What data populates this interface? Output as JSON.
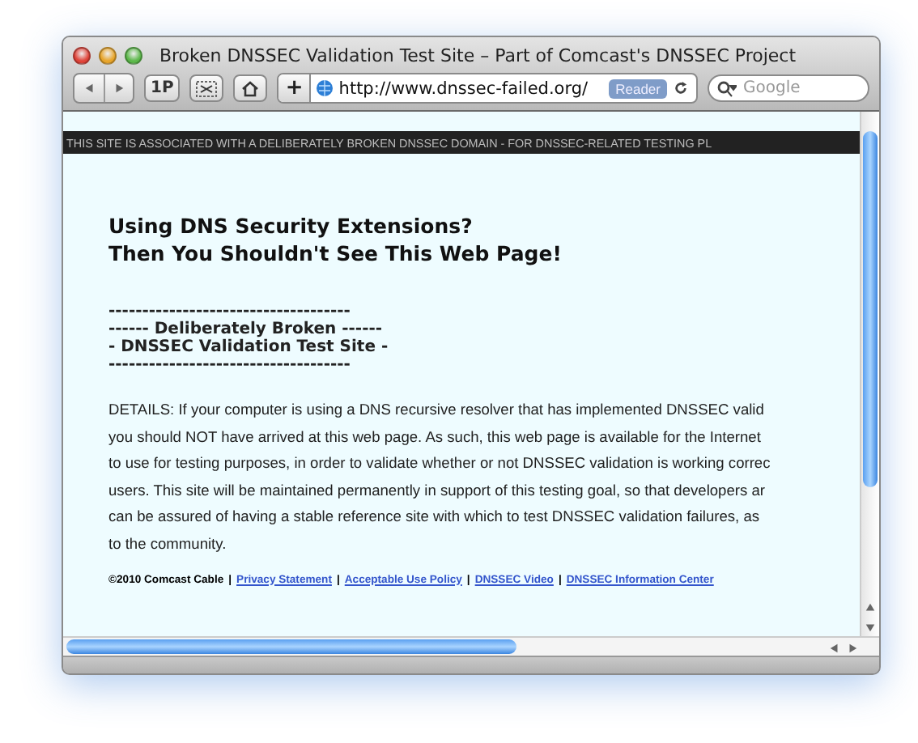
{
  "window": {
    "title": "Broken DNSSEC Validation Test Site – Part of Comcast's DNSSEC Project"
  },
  "toolbar": {
    "top_sites_label": "1P",
    "add_label": "+",
    "url": "http://www.dnssec-failed.org/",
    "reader": "Reader",
    "search_placeholder": "Google"
  },
  "page": {
    "banner": "THIS SITE IS ASSOCIATED WITH A DELIBERATELY BROKEN DNSSEC DOMAIN - FOR DNSSEC-RELATED TESTING PL",
    "heading": [
      "Using DNS Security Extensions?",
      "Then You Shouldn't See This Web Page!"
    ],
    "subtitle": [
      "------------------------------------",
      "------ Deliberately Broken ------",
      "- DNSSEC Validation Test Site -",
      "------------------------------------"
    ],
    "details": [
      "DETAILS: If your computer is using a DNS recursive resolver that has implemented DNSSEC valid",
      "you should NOT have arrived at this web page. As such, this web page is available for the Internet",
      "to use for testing purposes, in order to validate whether or not DNSSEC validation is working correc",
      "users. This site will be maintained permanently in support of this testing goal, so that developers ar",
      "can be assured of having a stable reference site with which to test DNSSEC validation failures, as",
      "to the community."
    ],
    "footer": {
      "copyright": "©2010 Comcast Cable",
      "separator": "|",
      "links": [
        "Privacy Statement",
        "Acceptable Use Policy",
        "DNSSEC Video",
        "DNSSEC Information Center"
      ]
    }
  }
}
